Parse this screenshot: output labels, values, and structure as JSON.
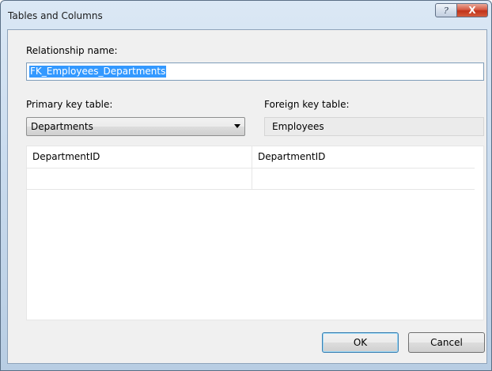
{
  "window": {
    "title": "Tables and Columns",
    "help_symbol": "?",
    "close_symbol": "X"
  },
  "relationship": {
    "label": "Relationship name:",
    "value": "FK_Employees_Departments"
  },
  "primary": {
    "label": "Primary key table:",
    "selected": "Departments"
  },
  "foreign": {
    "label": "Foreign key table:",
    "value": "Employees"
  },
  "columns": {
    "rows": [
      {
        "primary": "DepartmentID",
        "foreign": "DepartmentID"
      },
      {
        "primary": "",
        "foreign": ""
      }
    ]
  },
  "buttons": {
    "ok": "OK",
    "cancel": "Cancel"
  }
}
